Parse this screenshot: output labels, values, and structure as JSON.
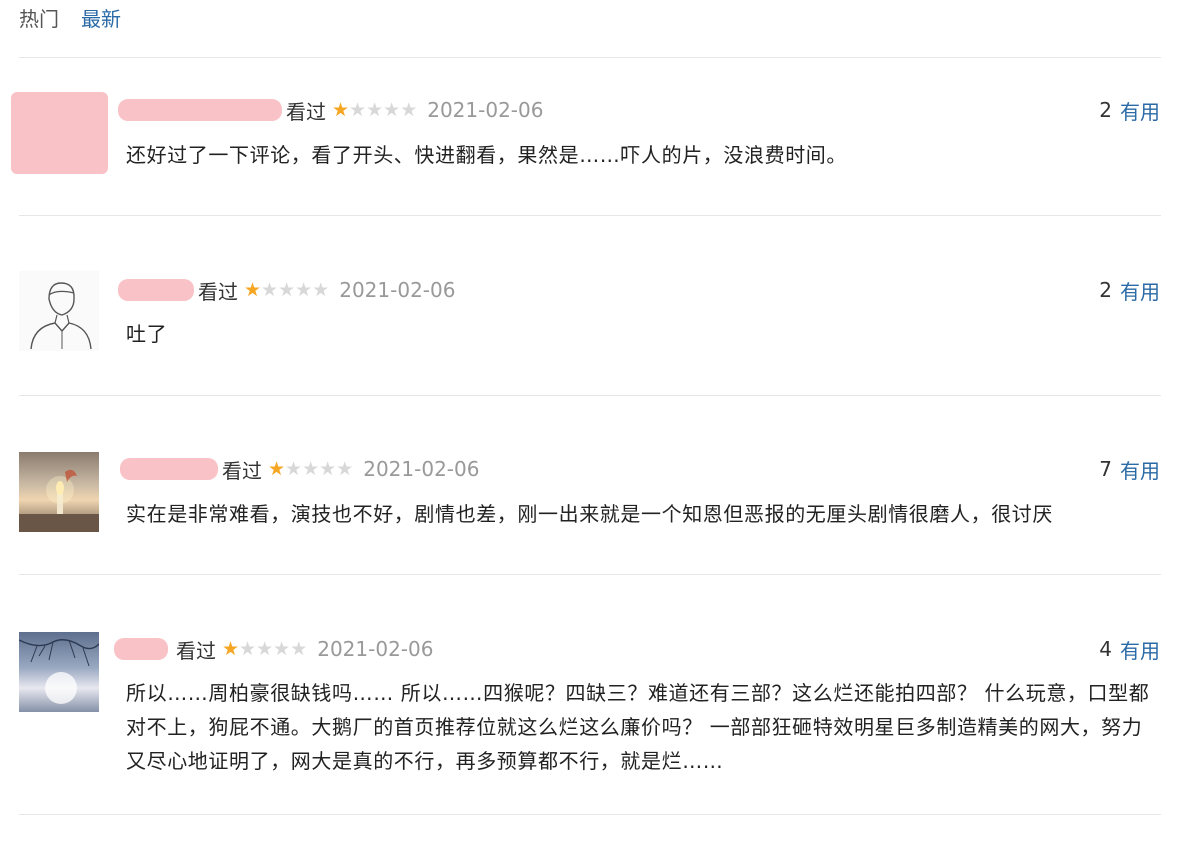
{
  "tabs": {
    "hot": "热门",
    "newest": "最新"
  },
  "status_word": "看过",
  "useful_label": "有用",
  "rating_colors": {
    "filled": "#f5a623",
    "empty": "#d8d8d8"
  },
  "comments": [
    {
      "date": "2021-02-06",
      "rating": 1,
      "votes": "2",
      "avatar": "pink-placeholder",
      "text": "还好过了一下评论，看了开头、快进翻看，果然是……吓人的片，没浪费时间。"
    },
    {
      "date": "2021-02-06",
      "rating": 1,
      "votes": "2",
      "avatar": "line-sketch-person",
      "text": "吐了"
    },
    {
      "date": "2021-02-06",
      "rating": 1,
      "votes": "7",
      "avatar": "candle-photo",
      "text": "实在是非常难看，演技也不好，剧情也差，刚一出来就是一个知恩但恶报的无厘头剧情很磨人，很讨厌"
    },
    {
      "date": "2021-02-06",
      "rating": 1,
      "votes": "4",
      "avatar": "branch-sky-photo",
      "text": "所以……周柏豪很缺钱吗…… 所以……四猴呢？四缺三？难道还有三部？这么烂还能拍四部？ 什么玩意，口型都对不上，狗屁不通。大鹅厂的首页推荐位就这么烂这么廉价吗？ 一部部狂砸特效明星巨多制造精美的网大，努力又尽心地证明了，网大是真的不行，再多预算都不行，就是烂……"
    }
  ]
}
